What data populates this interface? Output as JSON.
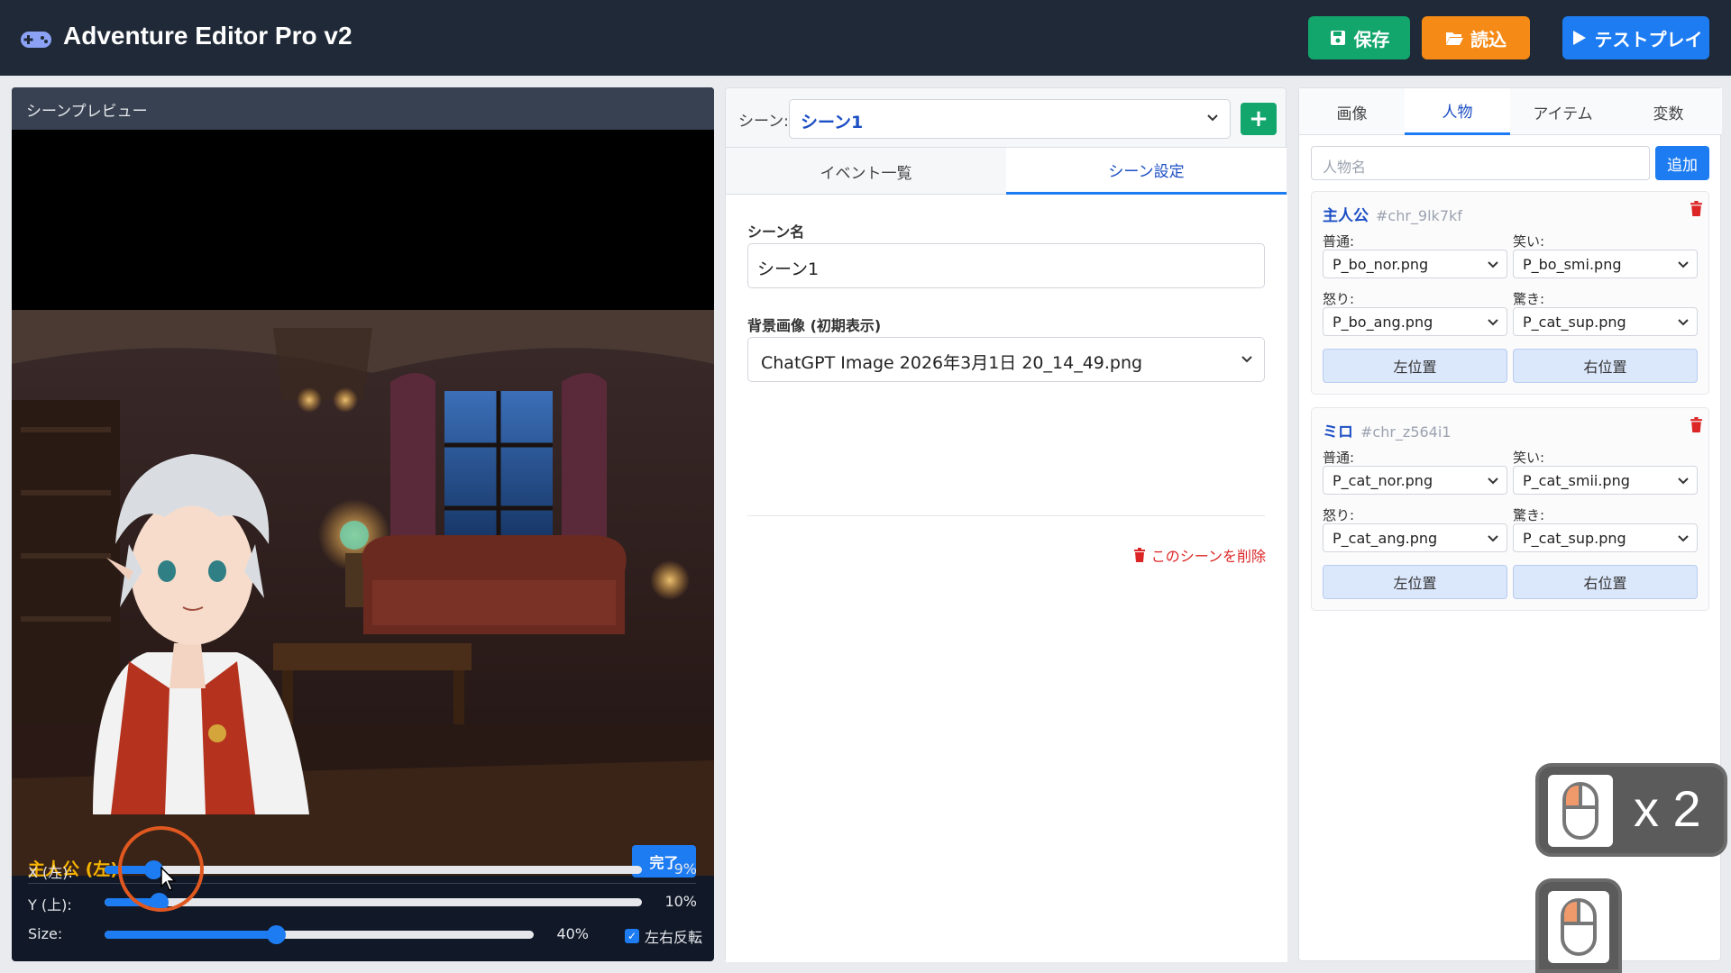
{
  "app": {
    "title": "Adventure Editor Pro v2"
  },
  "header": {
    "save_label": "保存",
    "load_label": "読込",
    "test_label": "テストプレイ"
  },
  "preview": {
    "title": "シーンプレビュー",
    "character": {
      "name": "主人公 (左)",
      "done_label": "完了",
      "x": {
        "label": "X (左):",
        "value": 9,
        "display": "9%"
      },
      "y": {
        "label": "Y (上):",
        "value": 10,
        "display": "10%"
      },
      "size": {
        "label": "Size:",
        "value": 40,
        "display": "40%"
      },
      "flip": {
        "label": "左右反転",
        "checked": true
      }
    }
  },
  "editor": {
    "scene_label": "シーン:",
    "scene_selected": "シーン1",
    "tabs": [
      {
        "label": "イベント一覧",
        "active": false
      },
      {
        "label": "シーン設定",
        "active": true
      }
    ],
    "scene_name_label": "シーン名",
    "scene_name_value": "シーン1",
    "bg_label": "背景画像 (初期表示)",
    "bg_value": "ChatGPT Image 2026年3月1日 20_14_49.png",
    "delete_label": "このシーンを削除"
  },
  "right": {
    "tabs": [
      {
        "label": "画像"
      },
      {
        "label": "人物",
        "active": true
      },
      {
        "label": "アイテム"
      },
      {
        "label": "変数"
      }
    ],
    "person_placeholder": "人物名",
    "add_label": "追加",
    "characters": [
      {
        "name": "主人公",
        "id": "#chr_9lk7kf",
        "normal_label": "普通:",
        "normal": "P_bo_nor.png",
        "smile_label": "笑い:",
        "smile": "P_bo_smi.png",
        "angry_label": "怒り:",
        "angry": "P_bo_ang.png",
        "surprise_label": "驚き:",
        "surprise": "P_cat_sup.png",
        "left_label": "左位置",
        "right_label": "右位置"
      },
      {
        "name": "ミロ",
        "id": "#chr_z564i1",
        "normal_label": "普通:",
        "normal": "P_cat_nor.png",
        "smile_label": "笑い:",
        "smile": "P_cat_smii.png",
        "angry_label": "怒り:",
        "angry": "P_cat_ang.png",
        "surprise_label": "驚き:",
        "surprise": "P_cat_sup.png",
        "left_label": "左位置",
        "right_label": "右位置"
      }
    ]
  },
  "overlay": {
    "click_count": "x 2"
  },
  "colors": {
    "accent": "#1e7cf2",
    "save": "#12a56c",
    "load": "#f58a16",
    "danger": "#dc2626",
    "header": "#1f2937",
    "char_name": "#f5b400"
  }
}
